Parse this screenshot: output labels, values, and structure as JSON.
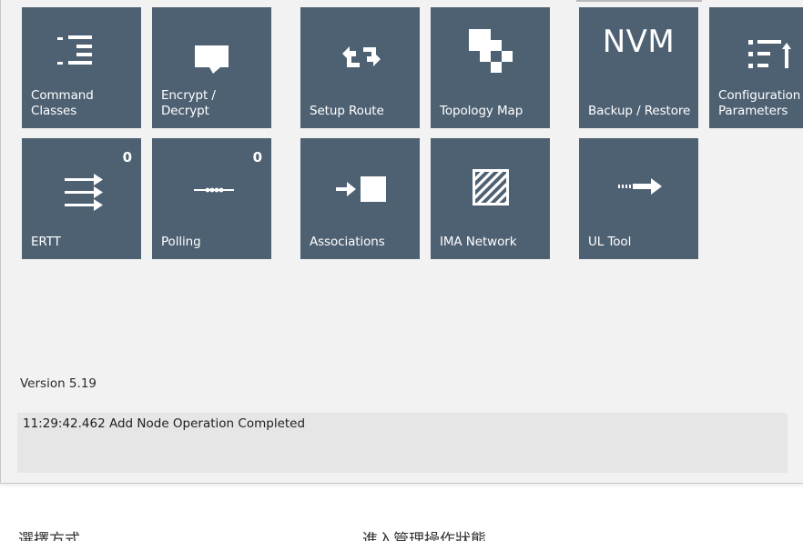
{
  "tiles_row1": [
    {
      "label": "Command\nClasses",
      "icon": "command-classes-icon"
    },
    {
      "label": "Encrypt / Decrypt",
      "icon": "speech-bubble-icon"
    },
    {
      "label": "Setup Route",
      "icon": "route-arrows-icon"
    },
    {
      "label": "Topology Map",
      "icon": "checker-grid-icon"
    },
    {
      "label": "Backup / Restore",
      "icon_text": "NVM"
    },
    {
      "label": "Configuration\nParameters",
      "icon": "config-list-arrow-icon"
    }
  ],
  "tiles_row2": [
    {
      "label": "ERTT",
      "count": "0",
      "icon": "triple-arrow-icon"
    },
    {
      "label": "Polling",
      "count": "0",
      "icon": "dotted-line-icon"
    },
    {
      "label": "Associations",
      "icon": "arrow-into-box-icon"
    },
    {
      "label": "IMA Network",
      "icon": "hatched-box-icon"
    },
    {
      "label": "UL Tool",
      "icon": "dashed-arrow-icon"
    }
  ],
  "version": "Version 5.19",
  "log": {
    "lines": [
      "11:29:42.462 Add Node Operation Completed"
    ]
  },
  "status_bar": {
    "left": "選擇方式",
    "right": "進入管理操作狀態"
  },
  "colors": {
    "tile_bg": "#4e6173",
    "window_bg": "#f2f2f2",
    "log_bg": "#e6e6e6"
  }
}
